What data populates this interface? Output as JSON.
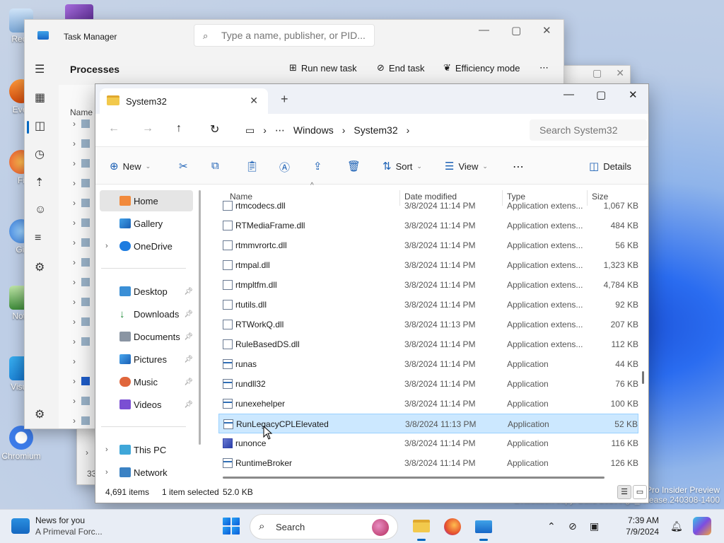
{
  "desktop": {
    "icons": [
      {
        "label": "Recy"
      },
      {
        "label": "Ever"
      },
      {
        "label": "Fi"
      },
      {
        "label": "Git"
      },
      {
        "label": "Note"
      },
      {
        "label": "Visua"
      },
      {
        "label": "Chromium"
      }
    ],
    "watermark": {
      "line1": "Pro Insider Preview",
      "line2": "Evaluation copy. Build 26100.ge_release.240308-1400"
    }
  },
  "back_window": {
    "status_left": "33"
  },
  "task_manager": {
    "title": "Task Manager",
    "search_placeholder": "Type a name, publisher, or PID...",
    "heading": "Processes",
    "actions": {
      "run_new_task": "Run new task",
      "end_task": "End task",
      "efficiency_mode": "Efficiency mode",
      "more": "⋯"
    },
    "list_header": "Name",
    "rail_icons": [
      "hamburger-icon",
      "processes-icon",
      "performance-icon",
      "app-history-icon",
      "startup-apps-icon",
      "users-icon",
      "details-icon",
      "services-icon",
      "settings-icon"
    ]
  },
  "explorer": {
    "tab_title": "System32",
    "new_tab": "+",
    "breadcrumb": [
      "⋯",
      "Windows",
      "System32"
    ],
    "search_placeholder": "Search System32",
    "commands": {
      "new": "New",
      "sort": "Sort",
      "view": "View",
      "more": "⋯",
      "details": "Details"
    },
    "nav": {
      "home": "Home",
      "gallery": "Gallery",
      "onedrive": "OneDrive",
      "desktop": "Desktop",
      "downloads": "Downloads",
      "documents": "Documents",
      "pictures": "Pictures",
      "music": "Music",
      "videos": "Videos",
      "this_pc": "This PC",
      "network": "Network"
    },
    "columns": {
      "name": "Name",
      "date": "Date modified",
      "type": "Type",
      "size": "Size"
    },
    "files": [
      {
        "name": "rtmcodecs.dll",
        "date": "3/8/2024 11:14 PM",
        "type": "Application extens...",
        "size": "1,067 KB",
        "icon": "dll"
      },
      {
        "name": "RTMediaFrame.dll",
        "date": "3/8/2024 11:14 PM",
        "type": "Application extens...",
        "size": "484 KB",
        "icon": "dll"
      },
      {
        "name": "rtmmvrortc.dll",
        "date": "3/8/2024 11:14 PM",
        "type": "Application extens...",
        "size": "56 KB",
        "icon": "dll"
      },
      {
        "name": "rtmpal.dll",
        "date": "3/8/2024 11:14 PM",
        "type": "Application extens...",
        "size": "1,323 KB",
        "icon": "dll"
      },
      {
        "name": "rtmpltfm.dll",
        "date": "3/8/2024 11:14 PM",
        "type": "Application extens...",
        "size": "4,784 KB",
        "icon": "dll"
      },
      {
        "name": "rtutils.dll",
        "date": "3/8/2024 11:14 PM",
        "type": "Application extens...",
        "size": "92 KB",
        "icon": "dll"
      },
      {
        "name": "RTWorkQ.dll",
        "date": "3/8/2024 11:13 PM",
        "type": "Application extens...",
        "size": "207 KB",
        "icon": "dll"
      },
      {
        "name": "RuleBasedDS.dll",
        "date": "3/8/2024 11:14 PM",
        "type": "Application extens...",
        "size": "112 KB",
        "icon": "dll"
      },
      {
        "name": "runas",
        "date": "3/8/2024 11:14 PM",
        "type": "Application",
        "size": "44 KB",
        "icon": "exe"
      },
      {
        "name": "rundll32",
        "date": "3/8/2024 11:14 PM",
        "type": "Application",
        "size": "76 KB",
        "icon": "exe"
      },
      {
        "name": "runexehelper",
        "date": "3/8/2024 11:14 PM",
        "type": "Application",
        "size": "100 KB",
        "icon": "exe"
      },
      {
        "name": "RunLegacyCPLElevated",
        "date": "3/8/2024 11:13 PM",
        "type": "Application",
        "size": "52 KB",
        "icon": "exe",
        "selected": true
      },
      {
        "name": "runonce",
        "date": "3/8/2024 11:14 PM",
        "type": "Application",
        "size": "116 KB",
        "icon": "run"
      },
      {
        "name": "RuntimeBroker",
        "date": "3/8/2024 11:14 PM",
        "type": "Application",
        "size": "126 KB",
        "icon": "exe"
      }
    ],
    "status": {
      "items": "4,691 items",
      "selected": "1 item selected",
      "size": "52.0 KB"
    }
  },
  "taskbar": {
    "news_title": "News for you",
    "news_sub": "A Primeval Forc...",
    "search_label": "Search",
    "time": "7:39 AM",
    "date": "7/9/2024"
  },
  "colors": {
    "accent": "#0067c0",
    "selection": "#cce8ff",
    "folder": "#f2c94c"
  }
}
